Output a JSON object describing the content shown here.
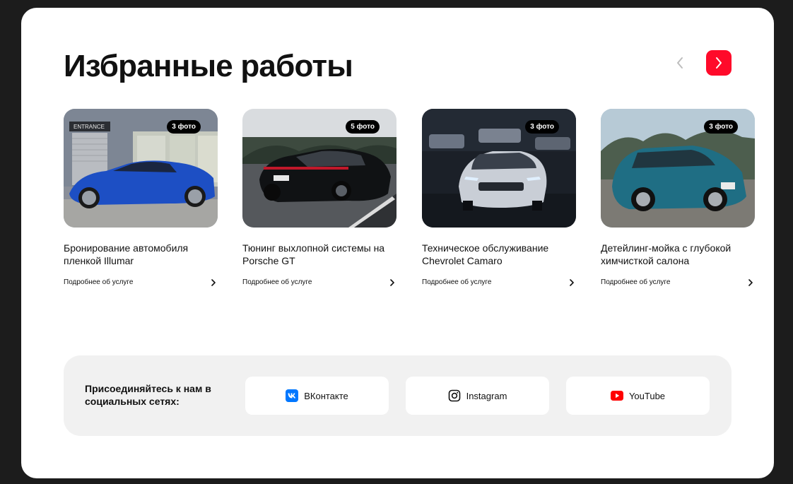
{
  "section": {
    "title": "Избранные работы"
  },
  "colors": {
    "accent": "#ff0a2a",
    "background": "#1c1c1c",
    "card": "#ffffff",
    "social_panel": "#f1f1f1"
  },
  "navigation": {
    "prev_icon": "chevron-left-icon",
    "next_icon": "chevron-right-icon"
  },
  "works": [
    {
      "badge": "3 фото",
      "title": "Бронирование автомобиля пленкой Illumar",
      "link": "Подробнее об услуге",
      "image_sign": "ENTRANCE"
    },
    {
      "badge": "5 фото",
      "title": "Тюнинг выхлопной системы на Porsche GT",
      "link": "Подробнее об услуге"
    },
    {
      "badge": "3 фото",
      "title": "Техническое обслуживание Chevrolet Camaro",
      "link": "Подробнее об услуге"
    },
    {
      "badge": "3 фото",
      "title": "Детейлинг-мойка с глубокой химчисткой салона",
      "link": "Подробнее об услуге"
    }
  ],
  "social": {
    "text": "Присоединяйтесь к нам в социальных сетях:",
    "buttons": [
      {
        "label": "ВКонтакте",
        "icon": "vk-icon"
      },
      {
        "label": "Instagram",
        "icon": "instagram-icon"
      },
      {
        "label": "YouTube",
        "icon": "youtube-icon"
      }
    ]
  }
}
